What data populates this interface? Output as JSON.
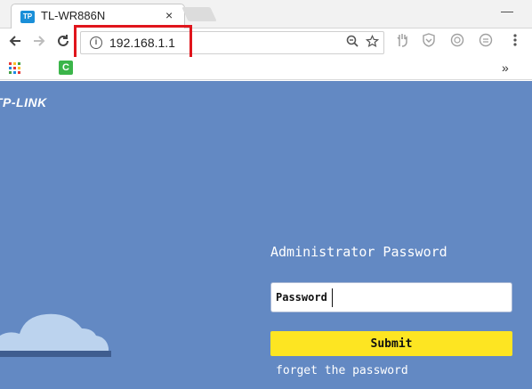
{
  "browser": {
    "tab": {
      "favicon_text": "TP",
      "title": "TL-WR886N",
      "close_label": "×"
    },
    "window_minimize": "—",
    "toolbar": {
      "back_icon": "back-arrow-icon",
      "forward_icon": "forward-arrow-icon",
      "reload_icon": "reload-icon",
      "url": "192.168.1.1",
      "zoom_icon": "zoom-icon",
      "star_icon": "star-icon",
      "extensions": [
        "hand-extension-icon",
        "shield-extension-icon",
        "emoji-extension-icon",
        "emoji-extension-icon-2"
      ],
      "menu_icon": "kebab-menu-icon"
    },
    "bookmarks": {
      "apps_icon": "apps-grid-icon",
      "bookmark_icon": "green-c-icon",
      "more_label": "»"
    }
  },
  "page": {
    "logo": "TP-LINK",
    "form_title": "Administrator Password",
    "password_label": "Password",
    "submit_label": "Submit",
    "forget_label": "forget the password"
  },
  "colors": {
    "page_background": "#6389c3",
    "submit_button": "#fde522",
    "highlight_border": "#e0151c",
    "cloud": "#bcd3ee"
  }
}
